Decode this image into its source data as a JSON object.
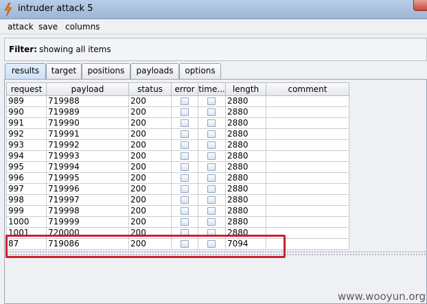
{
  "window": {
    "title": "intruder attack 5"
  },
  "menu": [
    "attack",
    "save",
    "columns"
  ],
  "filter": {
    "label": "Filter:",
    "value": "showing all items"
  },
  "tabs": [
    "results",
    "target",
    "positions",
    "payloads",
    "options"
  ],
  "active_tab": "results",
  "table": {
    "columns": [
      "request",
      "payload",
      "status",
      "error",
      "time...",
      "length",
      "comment"
    ],
    "rows": [
      [
        "989",
        "719988",
        "200",
        "2880"
      ],
      [
        "990",
        "719989",
        "200",
        "2880"
      ],
      [
        "991",
        "719990",
        "200",
        "2880"
      ],
      [
        "992",
        "719991",
        "200",
        "2880"
      ],
      [
        "993",
        "719992",
        "200",
        "2880"
      ],
      [
        "994",
        "719993",
        "200",
        "2880"
      ],
      [
        "995",
        "719994",
        "200",
        "2880"
      ],
      [
        "996",
        "719995",
        "200",
        "2880"
      ],
      [
        "997",
        "719996",
        "200",
        "2880"
      ],
      [
        "998",
        "719997",
        "200",
        "2880"
      ],
      [
        "999",
        "719998",
        "200",
        "2880"
      ],
      [
        "1000",
        "719999",
        "200",
        "2880"
      ],
      [
        "1001",
        "720000",
        "200",
        "2880"
      ],
      [
        "87",
        "719086",
        "200",
        "7094"
      ]
    ]
  },
  "watermark": "www.wooyun.org",
  "colors": {
    "highlight": "#cc1f2a",
    "active_tab": "#cfe0f5"
  }
}
